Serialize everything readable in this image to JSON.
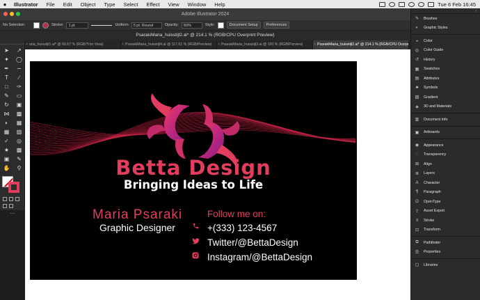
{
  "menubar": {
    "app": "Illustrator",
    "items": [
      "File",
      "Edit",
      "Object",
      "Type",
      "Select",
      "Effect",
      "View",
      "Window",
      "Help"
    ],
    "datetime": "Tue 6 Feb  16:45"
  },
  "window": {
    "title": "Adobe Illustrator 2024"
  },
  "control": {
    "selection": "No Selection",
    "stroke_label": "Stroke:",
    "stroke_value": "1 pt",
    "profile": "Uniform",
    "brush": "5 pt. Round",
    "opacity_label": "Opacity:",
    "opacity_value": "60%",
    "style_label": "Style:",
    "document_setup": "Document Setup",
    "preferences": "Preferences"
  },
  "document": {
    "title": "PsarakiMaria_huisstijl2.ai* @ 214.1 % (RGB/CPU Overprint Preview)"
  },
  "tabs": [
    {
      "label": "aria_huisstijl1.ai* @ 66.67 % (RGB/Trim View)"
    },
    {
      "label": "PsarakiMaria_huisstijl4.ai @ 117.61 % (RGB/Preview)"
    },
    {
      "label": "PsarakiMaria_huisstijl3.ai @ 150 % (RGB/Preview)"
    },
    {
      "label": "PsarakiMaria_huisstijl2.ai* @ 214.1 % (RGB/CPU Overpr"
    }
  ],
  "card": {
    "brand": "Betta Design",
    "tagline": "Bringing Ideas to Life",
    "name": "Maria Psaraki",
    "role": "Graphic Designer",
    "follow": "Follow me on:",
    "phone": "+(333) 123-4567",
    "twitter": "Twitter/@BettaDesign",
    "instagram": "Instagram/@BettaDesign"
  },
  "panels": [
    {
      "label": "Brushes",
      "icon": "brush-icon"
    },
    {
      "label": "Graphic Styles",
      "icon": "graphic-styles-icon"
    },
    {
      "label": "Color",
      "icon": "color-icon"
    },
    {
      "label": "Color Guide",
      "icon": "color-guide-icon"
    },
    {
      "label": "History",
      "icon": "history-icon"
    },
    {
      "label": "Swatches",
      "icon": "swatches-icon"
    },
    {
      "label": "Attributes",
      "icon": "attributes-icon"
    },
    {
      "label": "Symbols",
      "icon": "symbols-icon"
    },
    {
      "label": "Gradient",
      "icon": "gradient-icon"
    },
    {
      "label": "3D and Materials",
      "icon": "3d-icon"
    },
    {
      "label": "Document Info",
      "icon": "document-info-icon"
    },
    {
      "label": "Artboards",
      "icon": "artboards-icon"
    },
    {
      "label": "Appearance",
      "icon": "appearance-icon"
    },
    {
      "label": "Transparency",
      "icon": "transparency-icon"
    },
    {
      "label": "Align",
      "icon": "align-icon"
    },
    {
      "label": "Layers",
      "icon": "layers-icon"
    },
    {
      "label": "Character",
      "icon": "character-icon"
    },
    {
      "label": "Paragraph",
      "icon": "paragraph-icon"
    },
    {
      "label": "OpenType",
      "icon": "opentype-icon"
    },
    {
      "label": "Asset Export",
      "icon": "asset-export-icon"
    },
    {
      "label": "Stroke",
      "icon": "stroke-icon"
    },
    {
      "label": "Transform",
      "icon": "transform-icon"
    },
    {
      "label": "Pathfinder",
      "icon": "pathfinder-icon"
    },
    {
      "label": "Properties",
      "icon": "properties-icon"
    },
    {
      "label": "Libraries",
      "icon": "libraries-icon"
    }
  ],
  "colors": {
    "accent": "#e23d5e",
    "artboard": "#000000"
  }
}
